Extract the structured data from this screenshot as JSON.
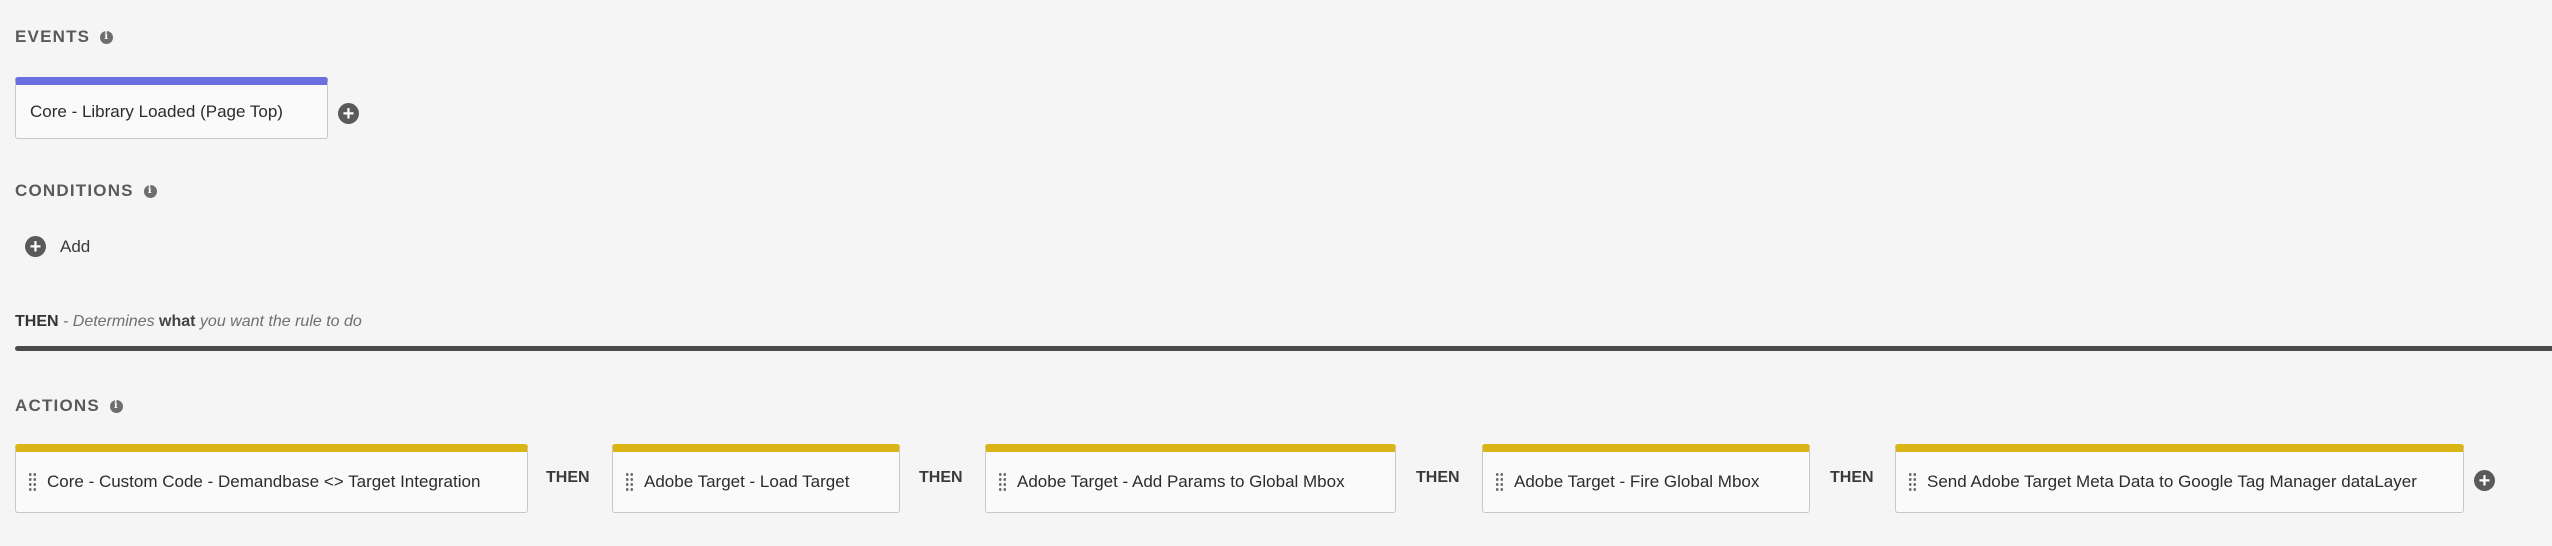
{
  "events": {
    "heading": "EVENTS",
    "items": [
      {
        "label": "Core - Library Loaded (Page Top)"
      }
    ]
  },
  "conditions": {
    "heading": "CONDITIONS",
    "add_label": "Add"
  },
  "then_section": {
    "title": "THEN",
    "desc_prefix": " - Determines ",
    "desc_bold": "what",
    "desc_suffix": " you want the rule to do"
  },
  "actions": {
    "heading": "ACTIONS",
    "separator_label": "THEN",
    "items": [
      {
        "label": "Core - Custom Code - Demandbase <> Target Integration"
      },
      {
        "label": "Adobe Target - Load Target"
      },
      {
        "label": "Adobe Target - Add Params to Global Mbox"
      },
      {
        "label": "Adobe Target - Fire Global Mbox"
      },
      {
        "label": "Send Adobe Target Meta Data to Google Tag Manager dataLayer"
      }
    ]
  },
  "icons": {
    "info": "info-icon",
    "add": "plus-circle-icon",
    "drag": "drag-handle-icon"
  },
  "colors": {
    "event_accent": "#6b6fe0",
    "action_accent": "#dbb416"
  }
}
